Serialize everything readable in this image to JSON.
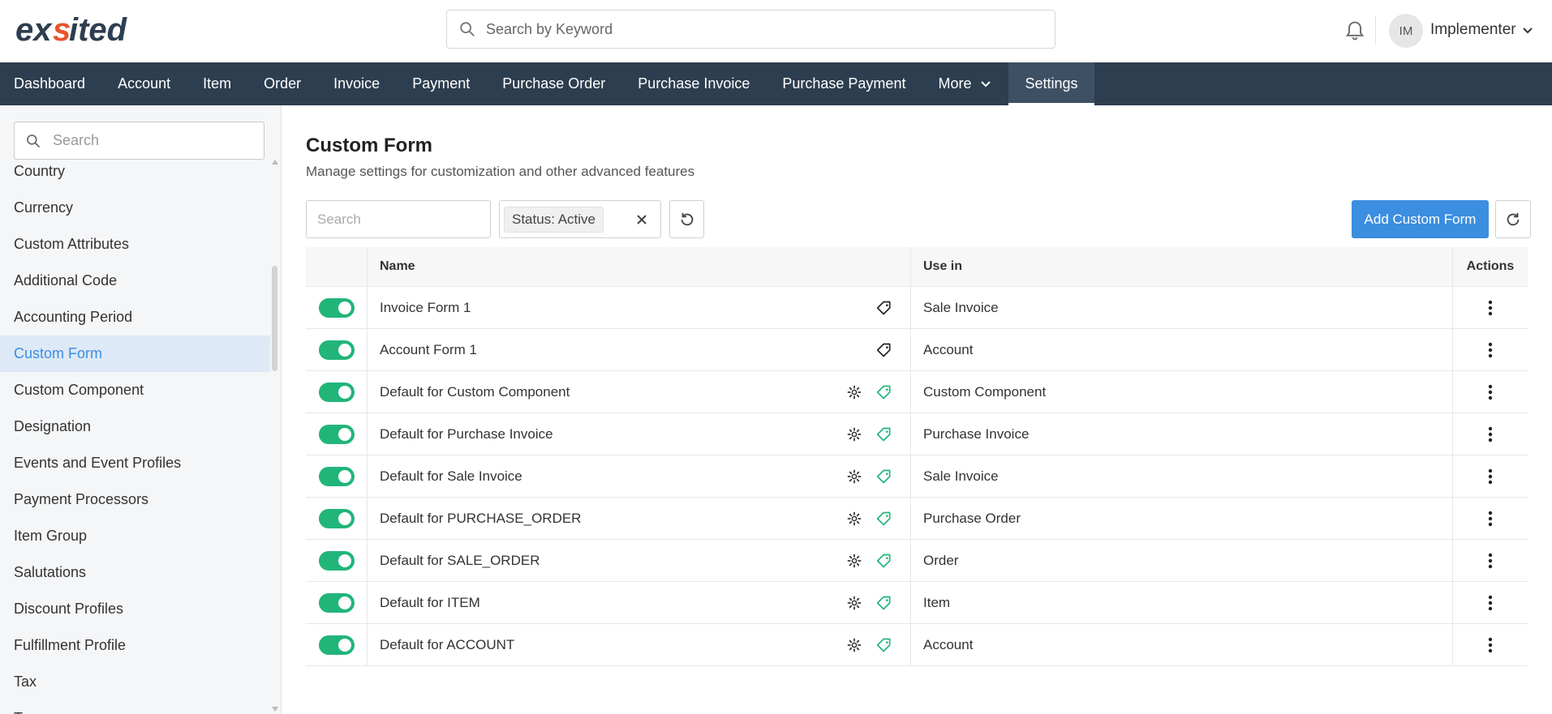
{
  "header": {
    "logo_text": "exsited",
    "search_placeholder": "Search by Keyword",
    "user_initials": "IM",
    "user_name": "Implementer"
  },
  "nav": {
    "items": [
      "Dashboard",
      "Account",
      "Item",
      "Order",
      "Invoice",
      "Payment",
      "Purchase Order",
      "Purchase Invoice",
      "Purchase Payment",
      "More",
      "Settings"
    ],
    "active": "Settings"
  },
  "sidebar": {
    "search_placeholder": "Search",
    "items": [
      "Country",
      "Currency",
      "Custom Attributes",
      "Additional Code",
      "Accounting Period",
      "Custom Form",
      "Custom Component",
      "Designation",
      "Events and Event Profiles",
      "Payment Processors",
      "Item Group",
      "Salutations",
      "Discount Profiles",
      "Fulfillment Profile",
      "Tax",
      "Teams"
    ],
    "active": "Custom Form"
  },
  "page": {
    "title": "Custom Form",
    "subtitle": "Manage settings for customization and other advanced features",
    "search_placeholder": "Search",
    "filter_chip": "Status: Active",
    "add_button": "Add Custom Form"
  },
  "table": {
    "headers": {
      "name": "Name",
      "use_in": "Use in",
      "actions": "Actions"
    },
    "rows": [
      {
        "name": "Invoice Form 1",
        "use_in": "Sale Invoice",
        "active": true,
        "has_gear": false,
        "tag_color": "#222222"
      },
      {
        "name": "Account Form 1",
        "use_in": "Account",
        "active": true,
        "has_gear": false,
        "tag_color": "#222222"
      },
      {
        "name": "Default for Custom Component",
        "use_in": "Custom Component",
        "active": true,
        "has_gear": true,
        "tag_color": "#21b57a"
      },
      {
        "name": "Default for Purchase Invoice",
        "use_in": "Purchase Invoice",
        "active": true,
        "has_gear": true,
        "tag_color": "#21b57a"
      },
      {
        "name": "Default for Sale Invoice",
        "use_in": "Sale Invoice",
        "active": true,
        "has_gear": true,
        "tag_color": "#21b57a"
      },
      {
        "name": "Default for PURCHASE_ORDER",
        "use_in": "Purchase Order",
        "active": true,
        "has_gear": true,
        "tag_color": "#21b57a"
      },
      {
        "name": "Default for SALE_ORDER",
        "use_in": "Order",
        "active": true,
        "has_gear": true,
        "tag_color": "#21b57a"
      },
      {
        "name": "Default for ITEM",
        "use_in": "Item",
        "active": true,
        "has_gear": true,
        "tag_color": "#21b57a"
      },
      {
        "name": "Default for ACCOUNT",
        "use_in": "Account",
        "active": true,
        "has_gear": true,
        "tag_color": "#21b57a"
      }
    ]
  },
  "colors": {
    "nav_bg": "#2d3e50",
    "accent": "#3b8ee0",
    "toggle_on": "#21b57a",
    "logo_accent": "#e8542a"
  },
  "icons": [
    "search-icon",
    "bell-icon",
    "chevron-down-icon",
    "close-icon",
    "refresh-icon",
    "gear-icon",
    "tag-icon",
    "kebab-icon"
  ]
}
